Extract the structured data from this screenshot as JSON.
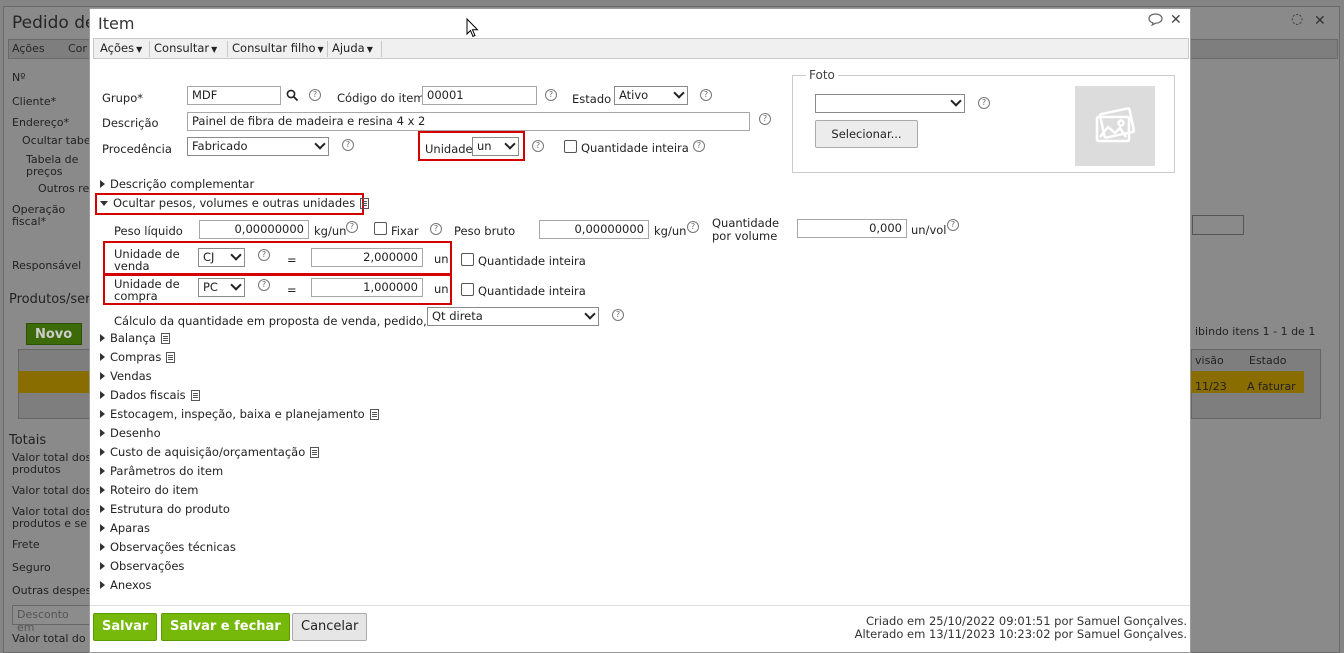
{
  "background": {
    "title": "Pedido de",
    "toolbar": [
      "Ações",
      "Cor"
    ],
    "labels": [
      "Nº",
      "Cliente*",
      "Endereço*",
      "Ocultar tabe",
      "Tabela de",
      "preços",
      "Outros re",
      "Operação",
      "fiscal*",
      "Responsável",
      "Produtos/ser",
      "Totais",
      "Valor total dos",
      "produtos",
      "Valor total dos",
      "Valor total dos",
      "produtos e se",
      "Frete",
      "Seguro",
      "Outras despes",
      "Valor total do"
    ],
    "new_button": "Novo",
    "discount_placeholder": "Desconto em",
    "grid_info": "ibindo itens 1 - 1 de 1",
    "grid_cols": [
      "visão",
      "Estado"
    ],
    "grid_row": [
      "11/23",
      "A faturar"
    ]
  },
  "dialog": {
    "title": "Item",
    "menus": [
      "Ações",
      "Consultar",
      "Consultar filho",
      "Ajuda"
    ],
    "fields": {
      "grupo_label": "Grupo*",
      "grupo_value": "MDF",
      "codigo_label": "Código do item",
      "codigo_value": "00001",
      "estado_label": "Estado",
      "estado_value": "Ativo",
      "descricao_label": "Descrição",
      "descricao_value": "Painel de fibra de madeira e resina 4 x 2",
      "procedencia_label": "Procedência",
      "procedencia_value": "Fabricado",
      "unidade_label": "Unidade",
      "unidade_value": "un",
      "qtd_inteira_label": "Quantidade inteira"
    },
    "foto": {
      "legend": "Foto",
      "select_value": "",
      "button": "Selecionar..."
    },
    "sections_top": {
      "desc_complementar": "Descrição complementar",
      "ocultar_pesos": "Ocultar pesos, volumes e outras unidades"
    },
    "pesos": {
      "peso_liquido_label": "Peso líquido",
      "peso_liquido_value": "0,00000000",
      "peso_liquido_unit": "kg/un",
      "fixar_label": "Fixar",
      "peso_bruto_label": "Peso bruto",
      "peso_bruto_value": "0,00000000",
      "peso_bruto_unit": "kg/un",
      "qtd_volume_label1": "Quantidade",
      "qtd_volume_label2": "por volume",
      "qtd_volume_value": "0,000",
      "qtd_volume_unit": "un/vol",
      "venda_label1": "Unidade de",
      "venda_label2": "venda",
      "venda_unit": "CJ",
      "venda_eq": "=",
      "venda_value": "2,000000",
      "venda_suffix": "un",
      "compra_label1": "Unidade de",
      "compra_label2": "compra",
      "compra_unit": "PC",
      "compra_eq": "=",
      "compra_value": "1,000000",
      "compra_suffix": "un",
      "qtd_inteira_label": "Quantidade inteira",
      "calculo_label": "Cálculo da quantidade em proposta de venda, pedido, NF",
      "calculo_value": "Qt direta"
    },
    "sections": [
      "Balança",
      "Compras",
      "Vendas",
      "Dados fiscais",
      "Estocagem, inspeção, baixa e planejamento",
      "Desenho",
      "Custo de aquisição/orçamentação",
      "Parâmetros do item",
      "Roteiro do item",
      "Estrutura do produto",
      "Aparas",
      "Observações técnicas",
      "Observações",
      "Anexos"
    ],
    "footer": {
      "save": "Salvar",
      "save_close": "Salvar e fechar",
      "cancel": "Cancelar",
      "created": "Criado em 25/10/2022 09:01:51 por Samuel Gonçalves.",
      "altered": "Alterado em 13/11/2023 10:23:02 por Samuel Gonçalves."
    }
  }
}
